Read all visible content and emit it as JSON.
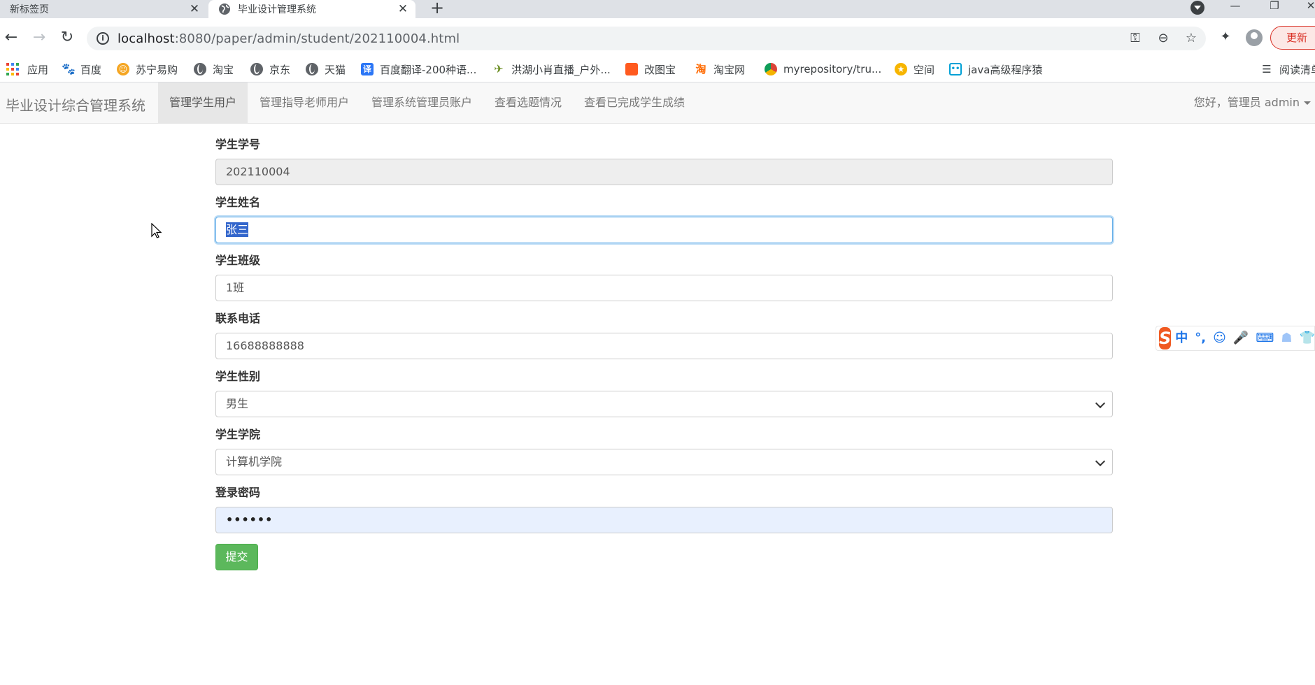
{
  "browser": {
    "tabs": [
      {
        "title": "新标签页",
        "active": false
      },
      {
        "title": "毕业设计管理系统",
        "active": true
      }
    ],
    "url_host": "localhost",
    "url_path": ":8080/paper/admin/student/202110004.html",
    "update_label": "更新",
    "bookmarks": [
      {
        "label": "应用",
        "icon": "apps-grid-icon"
      },
      {
        "label": "百度",
        "icon": "baidu-paw-icon",
        "color": "#2932e1"
      },
      {
        "label": "苏宁易购",
        "icon": "suning-icon",
        "color": "#f5a623"
      },
      {
        "label": "淘宝",
        "icon": "globe-icon"
      },
      {
        "label": "京东",
        "icon": "globe-icon"
      },
      {
        "label": "天猫",
        "icon": "globe-icon"
      },
      {
        "label": "百度翻译-200种语...",
        "icon": "translate-icon",
        "color": "#2b76f6"
      },
      {
        "label": "洪湖小肖直播_户外...",
        "icon": "bird-icon",
        "color": "#6b8e23"
      },
      {
        "label": "改图宝",
        "icon": "gaitubao-icon",
        "color": "#ff5a1f"
      },
      {
        "label": "淘宝网",
        "icon": "taobao-icon",
        "color": "#ff6a00"
      },
      {
        "label": "myrepository/tru...",
        "icon": "chrome-icon",
        "color": "#db4437"
      },
      {
        "label": "空间",
        "icon": "qzone-icon",
        "color": "#f7b500"
      },
      {
        "label": "java高级程序猿",
        "icon": "bilibili-icon",
        "color": "#00a1d6"
      }
    ],
    "reading_list_label": "阅读清单"
  },
  "app": {
    "brand": "毕业设计综合管理系统",
    "nav": [
      {
        "label": "管理学生用户",
        "active": true
      },
      {
        "label": "管理指导老师用户",
        "active": false
      },
      {
        "label": "管理系统管理员账户",
        "active": false
      },
      {
        "label": "查看选题情况",
        "active": false
      },
      {
        "label": "查看已完成学生成绩",
        "active": false
      }
    ],
    "user_menu": "您好，管理员 admin"
  },
  "form": {
    "student_id": {
      "label": "学生学号",
      "value": "202110004"
    },
    "student_name": {
      "label": "学生姓名",
      "value": "张三"
    },
    "student_class": {
      "label": "学生班级",
      "value": "1班"
    },
    "phone": {
      "label": "联系电话",
      "value": "16688888888"
    },
    "gender": {
      "label": "学生性别",
      "value": "男生"
    },
    "college": {
      "label": "学生学院",
      "value": "计算机学院"
    },
    "password": {
      "label": "登录密码",
      "value": "••••••"
    },
    "submit_label": "提交"
  },
  "ime": {
    "mode": "中",
    "punct": "°,"
  }
}
